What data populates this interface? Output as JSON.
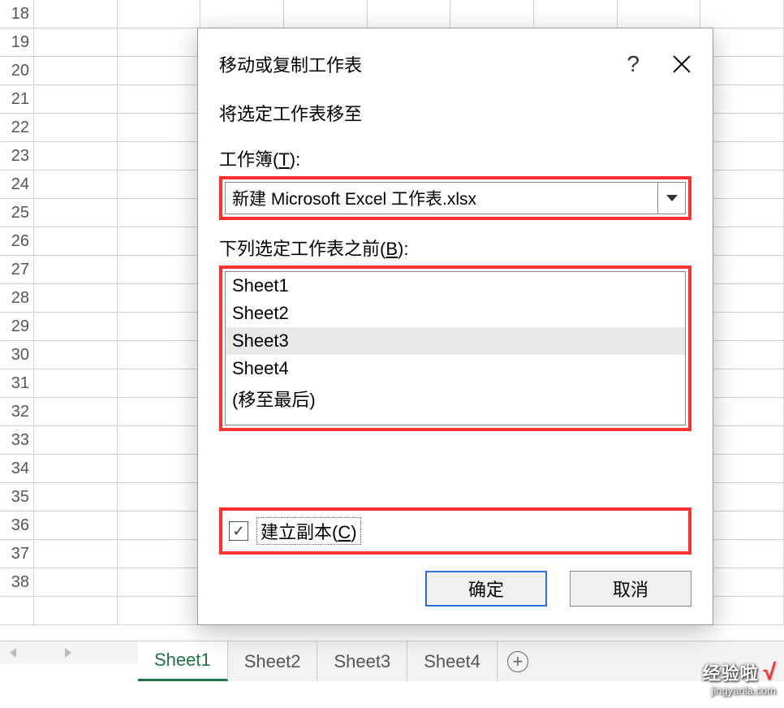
{
  "rows": [
    18,
    19,
    20,
    21,
    22,
    23,
    24,
    25,
    26,
    27,
    28,
    29,
    30,
    31,
    32,
    33,
    34,
    35,
    36,
    37,
    38
  ],
  "rowcount": 22,
  "colcount": 9,
  "tabs": [
    {
      "label": "Sheet1",
      "active": true
    },
    {
      "label": "Sheet2",
      "active": false
    },
    {
      "label": "Sheet3",
      "active": false
    },
    {
      "label": "Sheet4",
      "active": false
    }
  ],
  "dialog": {
    "title": "移动或复制工作表",
    "subtitle": "将选定工作表移至",
    "workbook_label_pre": "工作簿(",
    "workbook_label_key": "T",
    "workbook_label_post": "):",
    "workbook_value": "新建 Microsoft Excel 工作表.xlsx",
    "before_label_pre": "下列选定工作表之前(",
    "before_label_key": "B",
    "before_label_post": "):",
    "sheet_list": [
      {
        "label": "Sheet1",
        "selected": false
      },
      {
        "label": "Sheet2",
        "selected": false
      },
      {
        "label": "Sheet3",
        "selected": true
      },
      {
        "label": "Sheet4",
        "selected": false
      },
      {
        "label": "(移至最后)",
        "selected": false
      }
    ],
    "copy_label_pre": "建立副本(",
    "copy_label_key": "C",
    "copy_label_post": ")",
    "copy_checked": true,
    "ok": "确定",
    "cancel": "取消"
  },
  "watermark": {
    "brand": "经验啦",
    "url": "jingyanla.com"
  }
}
